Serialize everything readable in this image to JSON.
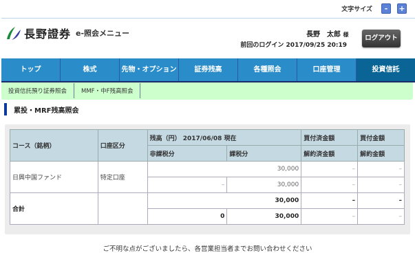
{
  "font_size": {
    "label": "文字サイズ",
    "minus": "-",
    "plus": "+"
  },
  "logo": {
    "name": "長野證券",
    "menu": "e-照会メニュー"
  },
  "user": {
    "name": "長野　太郎",
    "suffix": "様",
    "last_login": "前回のログイン 2017/09/25 20:19"
  },
  "logout_label": "ログアウト",
  "nav": [
    "トップ",
    "株式",
    "先物・オプション",
    "証券残高",
    "各種照会",
    "口座管理",
    "投資信託"
  ],
  "subnav": [
    "投資信託預り証券照会",
    "MMF・中F残高照会"
  ],
  "page_title": "累投・MRF残高照会",
  "table": {
    "headers": {
      "course": "コース（銘柄）",
      "account": "口座区分",
      "balance": "残高（円） 2017/06/08 現在",
      "nontax": "非課税分",
      "tax": "課税分",
      "buy_settled": "買付済金額",
      "buy": "買付金額",
      "cancel_settled": "解約済金額",
      "cancel": "解約金額"
    },
    "rows": [
      {
        "course": "日興中国ファンド",
        "account": "特定口座",
        "total": "30,000",
        "nontax": "–",
        "tax": "30,000",
        "buy_settled": "–",
        "buy": "–",
        "cancel_settled": "–",
        "cancel": "–"
      }
    ],
    "sum": {
      "label": "合計",
      "total": "30,000",
      "nontax": "0",
      "tax": "30,000",
      "buy_settled": "–",
      "buy": "–",
      "cancel_settled": "–",
      "cancel": "–"
    }
  },
  "footer": "ご不明な点がございましたら、各営業担当者までお問い合わせください"
}
